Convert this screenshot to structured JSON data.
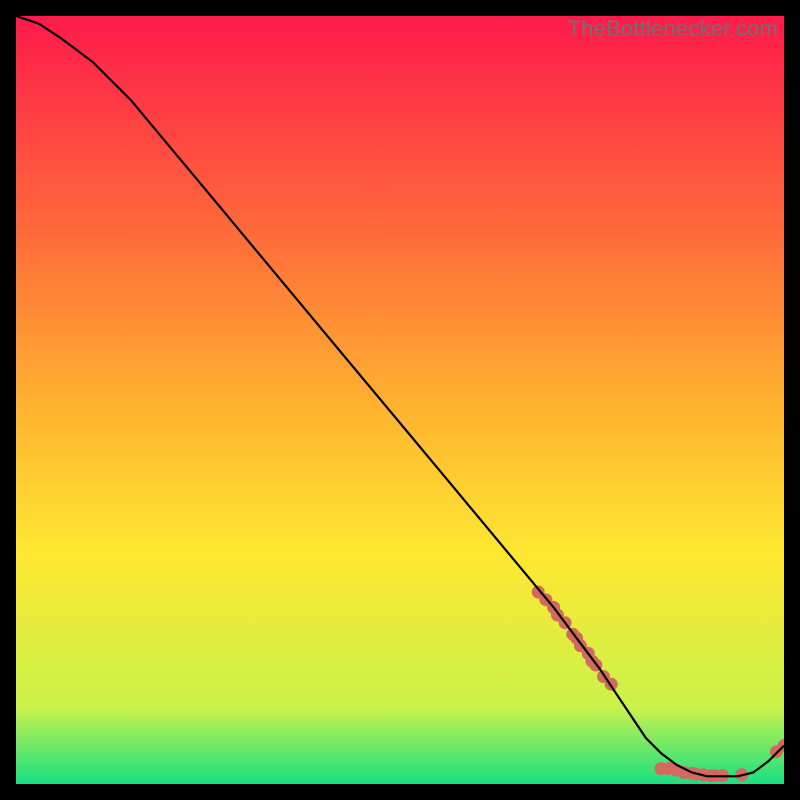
{
  "watermark": "TheBottlenecker.com",
  "colors": {
    "gradient_top": "#ff1a4b",
    "gradient_mid1": "#ff6a3a",
    "gradient_mid2": "#ffb030",
    "gradient_mid3": "#ffe831",
    "gradient_mid4": "#c9f24a",
    "gradient_bottom": "#18e082",
    "curve": "#000000",
    "dot": "#d46a5f",
    "frame_bg": "#000000"
  },
  "chart_data": {
    "type": "line",
    "title": "",
    "xlabel": "",
    "ylabel": "",
    "xlim": [
      0,
      100
    ],
    "ylim": [
      0,
      100
    ],
    "series": [
      {
        "name": "bottleneck-curve",
        "x": [
          0,
          3,
          6,
          10,
          15,
          20,
          25,
          30,
          35,
          40,
          45,
          50,
          55,
          60,
          65,
          70,
          73,
          76,
          78,
          80,
          82,
          84,
          86,
          88,
          90,
          92,
          94,
          96,
          98,
          100
        ],
        "y": [
          100,
          99,
          97,
          94,
          89,
          83,
          77,
          71,
          65,
          59,
          53,
          47,
          41,
          35,
          29,
          23,
          19,
          15,
          12,
          9,
          6,
          4,
          2.5,
          1.5,
          1,
          1,
          1,
          1.5,
          3,
          5
        ]
      }
    ],
    "dots": [
      {
        "x": 68,
        "y": 25
      },
      {
        "x": 69,
        "y": 24
      },
      {
        "x": 70,
        "y": 23
      },
      {
        "x": 70.5,
        "y": 22
      },
      {
        "x": 71.5,
        "y": 21
      },
      {
        "x": 72.5,
        "y": 19.5
      },
      {
        "x": 73,
        "y": 19
      },
      {
        "x": 73.5,
        "y": 18
      },
      {
        "x": 74.5,
        "y": 17
      },
      {
        "x": 75,
        "y": 16
      },
      {
        "x": 75.5,
        "y": 15.5
      },
      {
        "x": 76.5,
        "y": 14
      },
      {
        "x": 77.5,
        "y": 13
      },
      {
        "x": 84,
        "y": 2
      },
      {
        "x": 85,
        "y": 2
      },
      {
        "x": 86,
        "y": 1.8
      },
      {
        "x": 87,
        "y": 1.5
      },
      {
        "x": 88,
        "y": 1.4
      },
      {
        "x": 88.5,
        "y": 1.3
      },
      {
        "x": 89.5,
        "y": 1.2
      },
      {
        "x": 90.5,
        "y": 1.1
      },
      {
        "x": 91,
        "y": 1.1
      },
      {
        "x": 92,
        "y": 1.1
      },
      {
        "x": 94.5,
        "y": 1.2
      },
      {
        "x": 99,
        "y": 4.2
      },
      {
        "x": 100,
        "y": 5
      }
    ]
  }
}
